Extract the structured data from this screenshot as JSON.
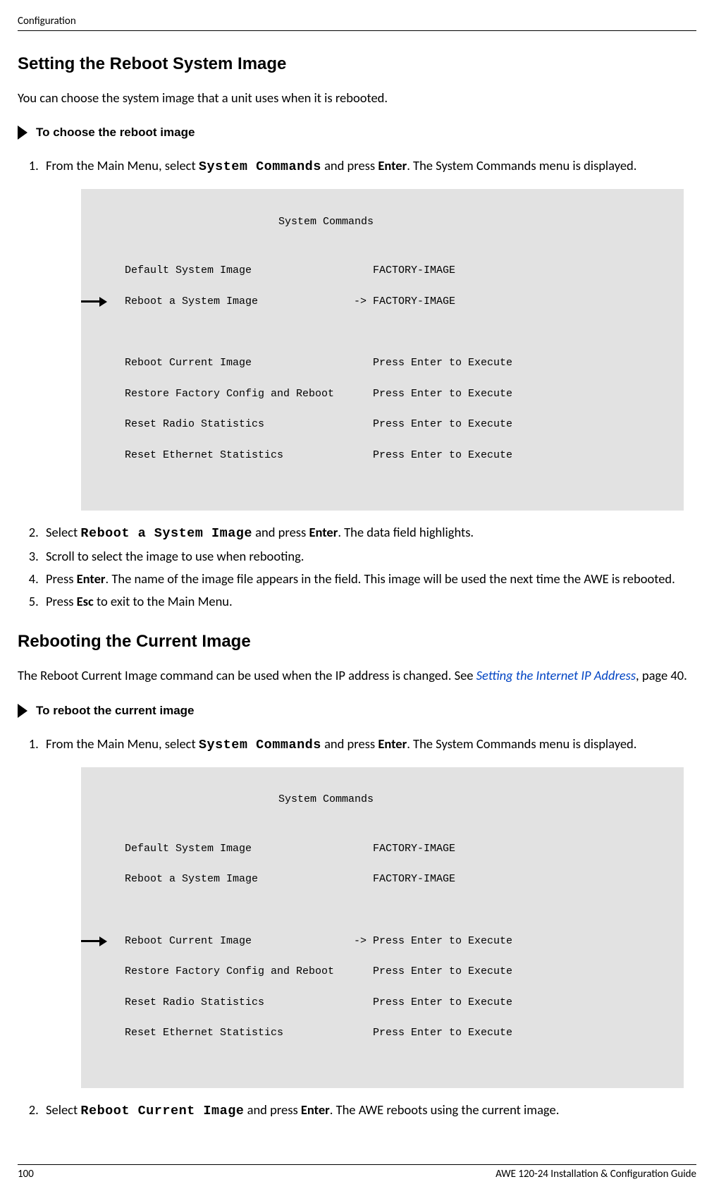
{
  "header": {
    "section": "Configuration"
  },
  "section1": {
    "title": "Setting the Reboot System Image",
    "intro": "You can choose the system image that a unit uses when it is rebooted.",
    "proc_title": "To choose the reboot image",
    "steps": {
      "s1_a": "From the Main Menu, select ",
      "s1_cmd": "System Commands",
      "s1_b": " and press ",
      "s1_key": "Enter",
      "s1_c": ". The System Commands menu is displayed.",
      "s2_a": "Select ",
      "s2_cmd": "Reboot a System Image",
      "s2_b": " and press ",
      "s2_key": "Enter",
      "s2_c": ". The data field highlights.",
      "s3": "Scroll to select the image to use when rebooting.",
      "s4_a": "Press ",
      "s4_key": "Enter",
      "s4_b": ". The name of the image file appears in the field. This image will be used the next time the AWE is rebooted.",
      "s5_a": "Press ",
      "s5_key": "Esc",
      "s5_b": " to exit to the Main Menu."
    },
    "terminal": {
      "title": "System Commands",
      "r1_label": "Default System Image",
      "r1_val": "   FACTORY-IMAGE",
      "r2_label": "Reboot a System Image",
      "r2_val": "-> FACTORY-IMAGE",
      "r3_label": "Reboot Current Image",
      "r3_val": "   Press Enter to Execute",
      "r4_label": "Restore Factory Config and Reboot",
      "r4_val": "   Press Enter to Execute",
      "r5_label": "Reset Radio Statistics",
      "r5_val": "   Press Enter to Execute",
      "r6_label": "Reset Ethernet Statistics",
      "r6_val": "   Press Enter to Execute"
    }
  },
  "section2": {
    "title": "Rebooting the Current Image",
    "intro_a": "The Reboot Current Image command can be used when the IP address is changed. See ",
    "intro_link": "Setting the Internet IP Address",
    "intro_b": ", page 40.",
    "proc_title": "To reboot the current image",
    "steps": {
      "s1_a": "From the Main Menu, select ",
      "s1_cmd": "System Commands",
      "s1_b": " and press ",
      "s1_key": "Enter",
      "s1_c": ". The System Commands menu is displayed.",
      "s2_a": "Select ",
      "s2_cmd": "Reboot Current Image",
      "s2_b": " and press ",
      "s2_key": "Enter",
      "s2_c": ". The AWE reboots using the current image."
    },
    "terminal": {
      "title": "System Commands",
      "r1_label": "Default System Image",
      "r1_val": "   FACTORY-IMAGE",
      "r2_label": "Reboot a System Image",
      "r2_val": "   FACTORY-IMAGE",
      "r3_label": "Reboot Current Image",
      "r3_val": "-> Press Enter to Execute",
      "r4_label": "Restore Factory Config and Reboot",
      "r4_val": "   Press Enter to Execute",
      "r5_label": "Reset Radio Statistics",
      "r5_val": "   Press Enter to Execute",
      "r6_label": "Reset Ethernet Statistics",
      "r6_val": "   Press Enter to Execute"
    }
  },
  "footer": {
    "page": "100",
    "guide": "AWE 120-24 Installation & Configuration Guide"
  }
}
